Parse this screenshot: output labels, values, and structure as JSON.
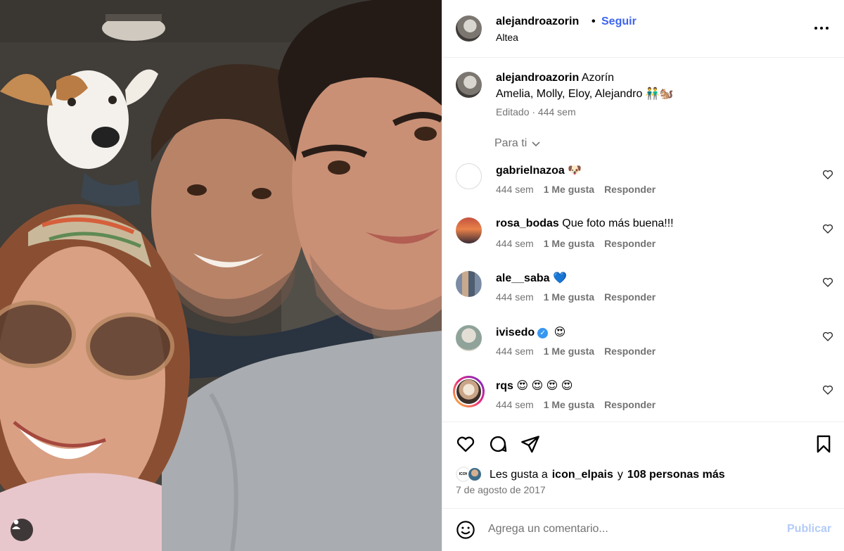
{
  "header": {
    "username": "alejandroazorin",
    "separator": "•",
    "follow_label": "Seguir",
    "location": "Altea",
    "more_icon": "more-horizontal-icon"
  },
  "caption": {
    "username": "alejandroazorin",
    "text_line1": "Azorín",
    "text_line2": "Amelia, Molly, Eloy, Alejandro 👬🐿️",
    "meta": "Editado · 444 sem"
  },
  "filter": {
    "label": "Para ti"
  },
  "comments": [
    {
      "username": "gabrielnazoa",
      "text": "🐶",
      "time": "444 sem",
      "likes": "1 Me gusta",
      "reply": "Responder",
      "verified": false
    },
    {
      "username": "rosa_bodas",
      "text": "Que foto más buena!!!",
      "time": "444 sem",
      "likes": "1 Me gusta",
      "reply": "Responder",
      "verified": false
    },
    {
      "username": "ale__saba",
      "text": "💙",
      "time": "444 sem",
      "likes": "1 Me gusta",
      "reply": "Responder",
      "verified": false
    },
    {
      "username": "ivisedo",
      "text": "😍",
      "time": "444 sem",
      "likes": "1 Me gusta",
      "reply": "Responder",
      "verified": true
    },
    {
      "username": "rqs",
      "text": "😍 😍 😍 😍",
      "time": "444 sem",
      "likes": "1 Me gusta",
      "reply": "Responder",
      "verified": false
    }
  ],
  "likes": {
    "prefix": "Les gusta a",
    "user": "icon_elpais",
    "connector": "y",
    "others": "108 personas más",
    "badge_text": "ICON"
  },
  "date": "7 de agosto de 2017",
  "composer": {
    "placeholder": "Agrega un comentario...",
    "publish_label": "Publicar"
  },
  "colors": {
    "follow": "#3d64f0",
    "muted": "#737373",
    "publish_disabled": "#b3cbf8",
    "divider": "#efefef"
  }
}
